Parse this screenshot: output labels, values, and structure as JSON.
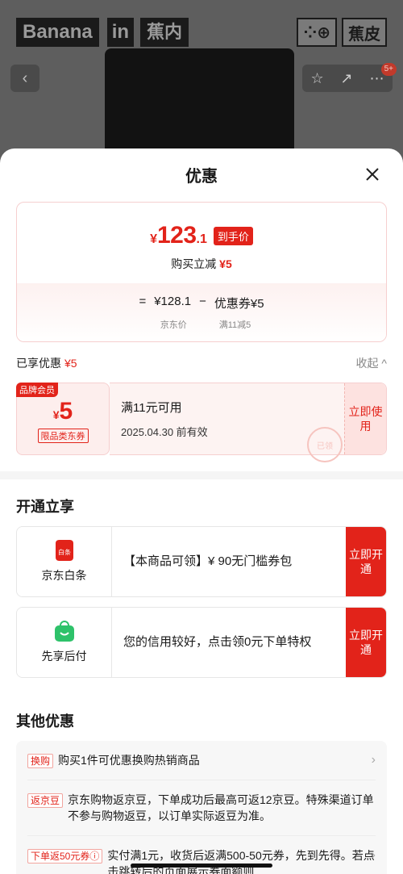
{
  "background": {
    "brand_name": "Banana",
    "brand_in": "in",
    "brand_cn": "蕉内",
    "right_logo_1": "⁘⊕",
    "right_logo_2": "蕉皮",
    "notif_count": "5+"
  },
  "sheet": {
    "title": "优惠"
  },
  "price_card": {
    "yen": "¥",
    "integer": "123",
    "decimal": ".1",
    "tag": "到手价",
    "sub_label": "购买立减",
    "sub_amount": "¥5",
    "formula_eq": "=",
    "formula_price": "¥128.1",
    "formula_minus": "−",
    "formula_coupon": "优惠券¥5",
    "label_price": "京东价",
    "label_coupon": "满11减5"
  },
  "enjoyed": {
    "label": "已享优惠",
    "amount": "¥5",
    "collapse": "收起 ^"
  },
  "coupon": {
    "badge": "品牌会员",
    "yen": "¥",
    "amount": "5",
    "type": "限品类东券",
    "condition": "满11元可用",
    "expiry": "2025.04.30 前有效",
    "use_btn": "立即使用",
    "stamp": "已领"
  },
  "open_section": {
    "title": "开通立享",
    "items": [
      {
        "name": "京东白条",
        "icon": "baitiao-icon",
        "icon_text": "白条",
        "text": "【本商品可领】¥ 90无门槛券包",
        "btn": "立即开通"
      },
      {
        "name": "先享后付",
        "icon": "shopping-bag-icon",
        "text": "您的信用较好，点击领0元下单特权",
        "btn": "立即开通"
      }
    ]
  },
  "other_section": {
    "title": "其他优惠",
    "items": [
      {
        "tag": "换购",
        "text": "购买1件可优惠换购热销商品"
      },
      {
        "tag": "返京豆",
        "text": "京东购物返京豆，下单成功后最高可返12京豆。特殊渠道订单不参与购物返豆，以订单实际返豆为准。"
      },
      {
        "tag": "下单返50元券ⓘ",
        "text": "实付满1元，收货后返满500-50元券，先到先得。若点击跳转后的页面展示券面额则"
      }
    ]
  },
  "colors": {
    "accent": "#e2231a",
    "coupon_bg": "#fdeeed",
    "green": "#2ec26a"
  }
}
